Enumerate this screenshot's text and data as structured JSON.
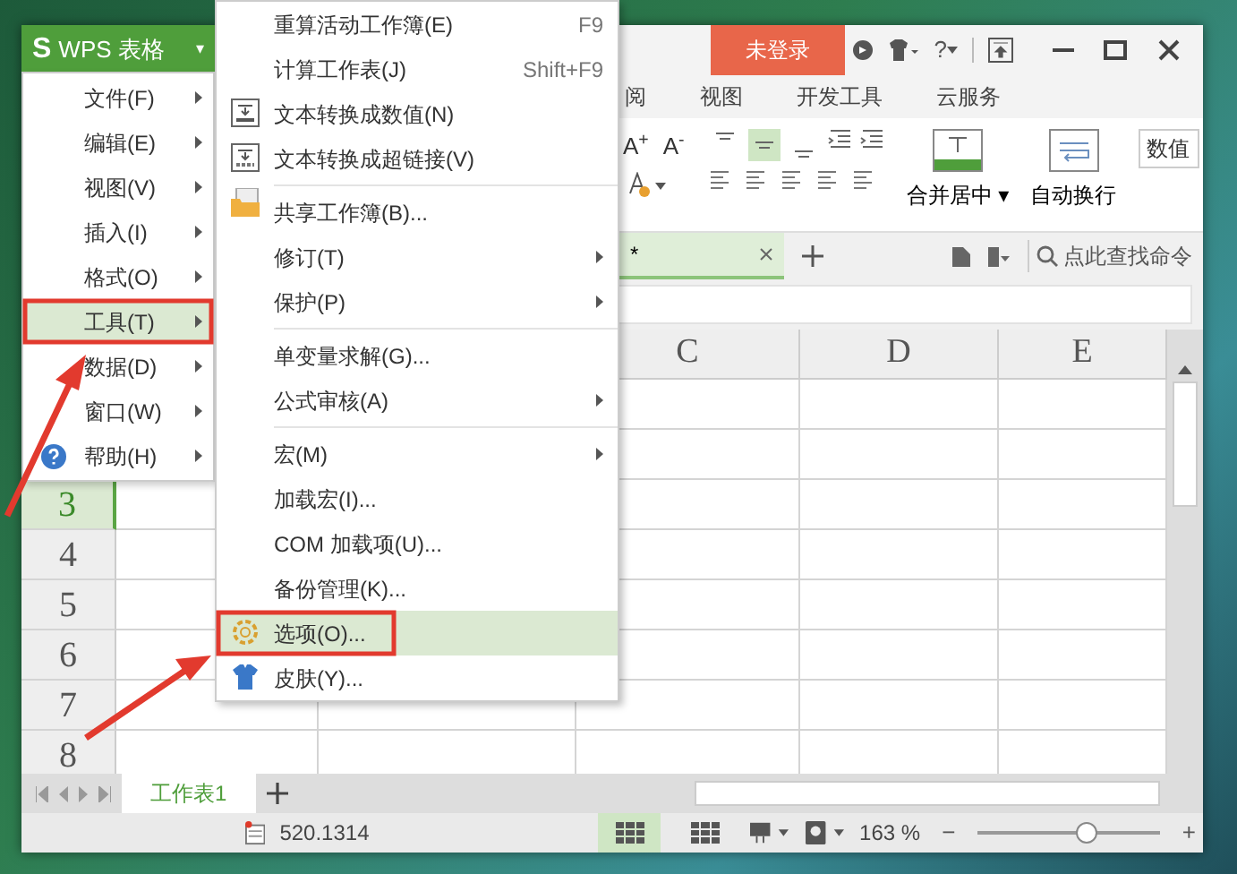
{
  "app_button": {
    "logo": "S",
    "label": "WPS 表格",
    "caret": "▾"
  },
  "title_bar": {
    "login_button": "未登录",
    "help": "?"
  },
  "ribbon_tabs": [
    {
      "label": "阅",
      "selected": false
    },
    {
      "label": "视图",
      "selected": false
    },
    {
      "label": "开发工具",
      "selected": false
    },
    {
      "label": "云服务",
      "selected": false
    }
  ],
  "ribbon": {
    "font_buttons": [
      "A$^{+}$",
      "A$^{-}$"
    ],
    "align_buttons": [
      {
        "selected": false
      },
      {
        "selected": true
      },
      {
        "selected": false
      }
    ],
    "merge_button": "合并居中",
    "merge_caret": "▾",
    "wrap_button": "自动换行",
    "number_format": "数值"
  },
  "doc_tabs": [
    {
      "label": "*",
      "selected": true
    }
  ],
  "search": {
    "placeholder": "点此查找命令"
  },
  "sheet": {
    "columns": [
      "C",
      "D",
      "E"
    ],
    "row_numbers": [
      "3",
      "4",
      "5",
      "6",
      "7",
      "8"
    ]
  },
  "sheet_tabs": [
    {
      "label": "工作表1",
      "selected": true
    }
  ],
  "status_bar": {
    "value": "520.1314",
    "views": [
      {
        "selected": true
      },
      {
        "selected": false
      }
    ],
    "zoom": "163 %",
    "zoom_out": "−",
    "zoom_in": "+",
    "zoom_slider": {
      "level": 0.6
    }
  },
  "main_menu": [
    {
      "label": "文件(F)",
      "has_submenu": true,
      "selected": false,
      "has_icon": false
    },
    {
      "label": "编辑(E)",
      "has_submenu": true,
      "selected": false,
      "has_icon": false
    },
    {
      "label": "视图(V)",
      "has_submenu": true,
      "selected": false,
      "has_icon": false
    },
    {
      "label": "插入(I)",
      "has_submenu": true,
      "selected": false,
      "has_icon": false
    },
    {
      "label": "格式(O)",
      "has_submenu": true,
      "selected": false,
      "has_icon": false
    },
    {
      "label": "工具(T)",
      "has_submenu": true,
      "selected": true,
      "has_icon": false
    },
    {
      "label": "数据(D)",
      "has_submenu": true,
      "selected": false,
      "has_icon": false
    },
    {
      "label": "窗口(W)",
      "has_submenu": true,
      "selected": false,
      "has_icon": false
    },
    {
      "label": "帮助(H)",
      "has_submenu": true,
      "selected": false,
      "has_icon": true
    }
  ],
  "submenu": [
    {
      "label": "重算活动工作簿(E)",
      "shortcut": "F9",
      "has_submenu": false,
      "selected": false,
      "has_icon": false,
      "separator_before": false
    },
    {
      "label": "计算工作表(J)",
      "shortcut": "Shift+F9",
      "has_submenu": false,
      "selected": false,
      "has_icon": false,
      "separator_before": false
    },
    {
      "label": "文本转换成数值(N)",
      "has_submenu": false,
      "selected": false,
      "has_icon": true,
      "separator_before": false
    },
    {
      "label": "文本转换成超链接(V)",
      "has_submenu": false,
      "selected": false,
      "has_icon": true,
      "separator_before": false
    },
    {
      "label": "共享工作簿(B)...",
      "has_submenu": false,
      "selected": false,
      "has_icon": true,
      "separator_before": true
    },
    {
      "label": "修订(T)",
      "has_submenu": true,
      "selected": false,
      "has_icon": false,
      "separator_before": false
    },
    {
      "label": "保护(P)",
      "has_submenu": true,
      "selected": false,
      "has_icon": false,
      "separator_before": false
    },
    {
      "label": "单变量求解(G)...",
      "has_submenu": false,
      "selected": false,
      "has_icon": false,
      "separator_before": true
    },
    {
      "label": "公式审核(A)",
      "has_submenu": true,
      "selected": false,
      "has_icon": false,
      "separator_before": false
    },
    {
      "label": "宏(M)",
      "has_submenu": true,
      "selected": false,
      "has_icon": false,
      "separator_before": true
    },
    {
      "label": "加载宏(I)...",
      "has_submenu": false,
      "selected": false,
      "has_icon": false,
      "separator_before": false
    },
    {
      "label": "COM 加载项(U)...",
      "has_submenu": false,
      "selected": false,
      "has_icon": false,
      "separator_before": false
    },
    {
      "label": "备份管理(K)...",
      "has_submenu": false,
      "selected": false,
      "has_icon": false,
      "separator_before": false
    },
    {
      "label": "选项(O)...",
      "has_submenu": false,
      "selected": true,
      "has_icon": true,
      "separator_before": false
    },
    {
      "label": "皮肤(Y)...",
      "has_submenu": false,
      "selected": false,
      "has_icon": true,
      "separator_before": false
    }
  ]
}
